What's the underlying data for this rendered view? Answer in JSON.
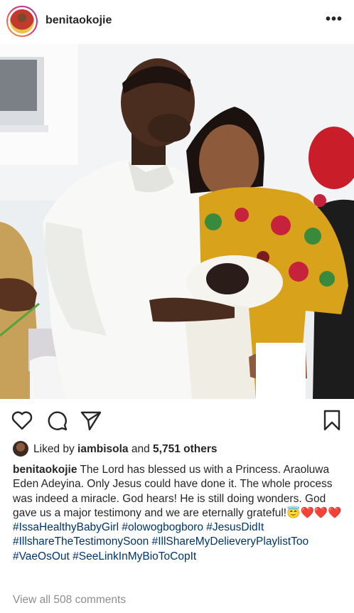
{
  "post": {
    "username": "benitaokojie",
    "more_icon": "•••"
  },
  "likes": {
    "prefix": "Liked by ",
    "liker": "iambisola",
    "middle": " and ",
    "count": "5,751 others"
  },
  "caption": {
    "username": "benitaokojie",
    "text": " The Lord has blessed us with a Princess. Araoluwa Eden Adeyina. Only Jesus could have done it. The whole process was indeed a miracle. God hears! He is still doing wonders. God gave us a major testimony and we are eternally grateful!",
    "emoji": "😇",
    "hearts": "❤️❤️❤️",
    "hashtags": [
      "#IssaHealthyBabyGirl",
      "#olowogbogboro",
      "#JesusDidIt",
      "#IllshareTheTestimonySoon",
      "#IllShareMyDelieveryPlaylistToo",
      "#VaeOsOut",
      "#SeeLinkInMyBioToCopIt"
    ]
  },
  "comments": {
    "view_all": "View all 508 comments"
  },
  "icons": {
    "heart": "heart-icon",
    "comment": "comment-icon",
    "share": "share-icon",
    "save": "bookmark-icon"
  }
}
